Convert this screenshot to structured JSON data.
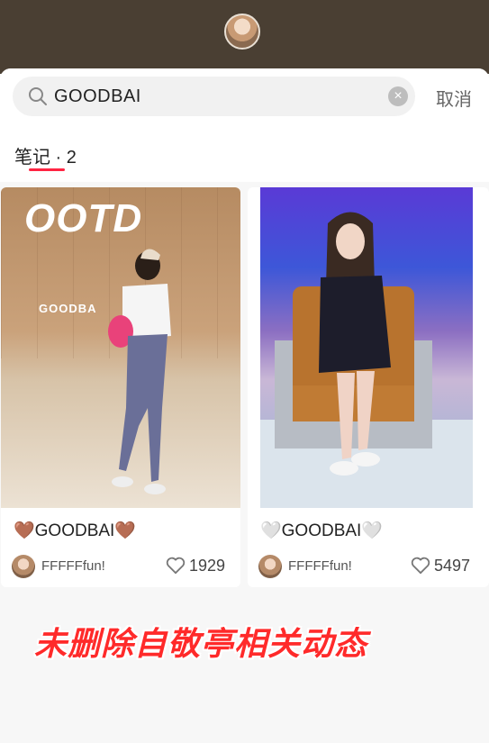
{
  "search": {
    "query": "GOODBAI",
    "cancel_label": "取消"
  },
  "tabs": {
    "notes_label": "笔记 · 2"
  },
  "notes": [
    {
      "title": "🤎GOODBAI🤎",
      "author": "FFFFFfun!",
      "likes": "1929",
      "photo_overlay": "OOTD",
      "wall_text": "GOODBA"
    },
    {
      "title": "🤍GOODBAI🤍",
      "author": "FFFFFfun!",
      "likes": "5497"
    }
  ],
  "caption": "未删除自敬亭相关动态",
  "colors": {
    "accent": "#ff2442",
    "caption": "#ff2a2a",
    "topbar": "#4a3f33"
  }
}
